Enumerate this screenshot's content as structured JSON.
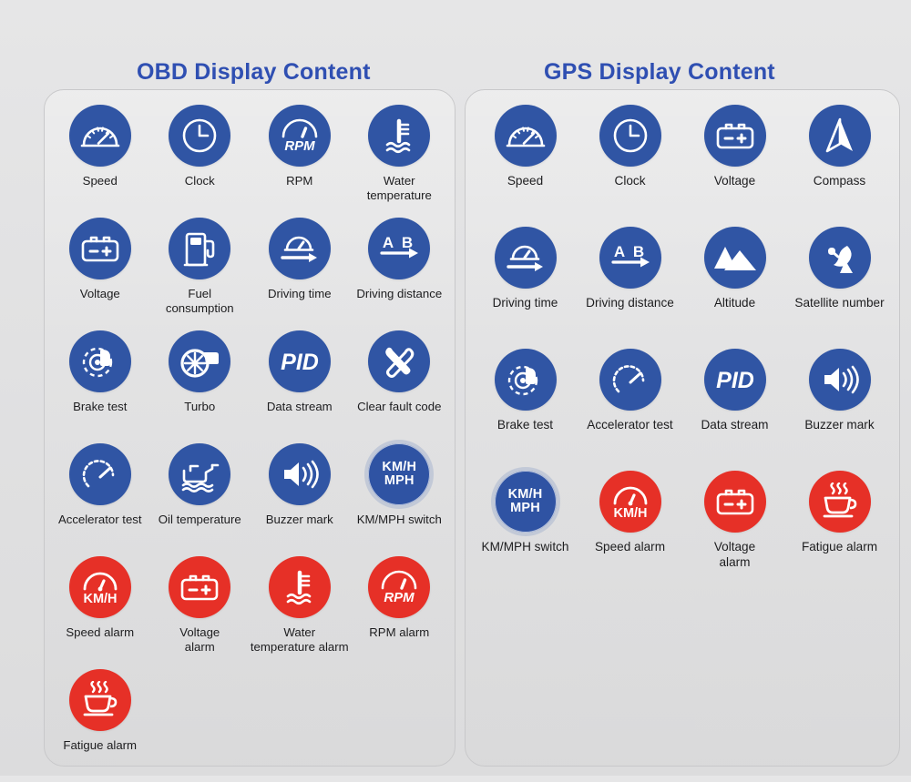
{
  "theme": {
    "background": "#e3e3e4",
    "panel_border": "#c8c8ca",
    "title_color": "#2f4fb2",
    "badge_blue": "#3055a4",
    "badge_red": "#e63027",
    "caption_color": "#1d1d1f"
  },
  "panels": [
    {
      "id": "obd",
      "title": "OBD Display Content",
      "items": [
        {
          "label": "Speed",
          "icon": "speedometer-icon",
          "color": "blue"
        },
        {
          "label": "Clock",
          "icon": "clock-icon",
          "color": "blue"
        },
        {
          "label": "RPM",
          "icon": "rpm-gauge-icon",
          "color": "blue"
        },
        {
          "label": "Water\ntemperature",
          "icon": "water-temperature-icon",
          "color": "blue"
        },
        {
          "label": "Voltage",
          "icon": "battery-icon",
          "color": "blue"
        },
        {
          "label": "Fuel\nconsumption",
          "icon": "fuel-pump-icon",
          "color": "blue"
        },
        {
          "label": "Driving time",
          "icon": "driving-time-icon",
          "color": "blue"
        },
        {
          "label": "Driving distance",
          "icon": "driving-distance-icon",
          "color": "blue"
        },
        {
          "label": "Brake test",
          "icon": "brake-disc-icon",
          "color": "blue"
        },
        {
          "label": "Turbo",
          "icon": "turbo-icon",
          "color": "blue"
        },
        {
          "label": "Data stream",
          "icon": "pid-icon",
          "color": "blue"
        },
        {
          "label": "Clear fault code",
          "icon": "wrench-spanner-icon",
          "color": "blue"
        },
        {
          "label": "Accelerator test",
          "icon": "accelerator-gauge-icon",
          "color": "blue"
        },
        {
          "label": "Oil temperature",
          "icon": "oil-can-icon",
          "color": "blue"
        },
        {
          "label": "Buzzer mark",
          "icon": "speaker-icon",
          "color": "blue"
        },
        {
          "label": "KM/MPH switch",
          "icon": "km-mph-switch-icon",
          "color": "blue-ring",
          "glyph": "KM/H\nMPH"
        },
        {
          "label": "Speed alarm",
          "icon": "speed-alarm-icon",
          "color": "red",
          "glyph": "KM/H"
        },
        {
          "label": "Voltage\nalarm",
          "icon": "battery-icon",
          "color": "red"
        },
        {
          "label": "Water\ntemperature alarm",
          "icon": "water-temperature-icon",
          "color": "red"
        },
        {
          "label": "RPM alarm",
          "icon": "rpm-gauge-icon",
          "color": "red"
        },
        {
          "label": "Fatigue alarm",
          "icon": "coffee-cup-icon",
          "color": "red"
        }
      ]
    },
    {
      "id": "gps",
      "title": "GPS Display Content",
      "items": [
        {
          "label": "Speed",
          "icon": "speedometer-icon",
          "color": "blue"
        },
        {
          "label": "Clock",
          "icon": "clock-icon",
          "color": "blue"
        },
        {
          "label": "Voltage",
          "icon": "battery-icon",
          "color": "blue"
        },
        {
          "label": "Compass",
          "icon": "compass-arrow-icon",
          "color": "blue"
        },
        {
          "label": "Driving time",
          "icon": "driving-time-icon",
          "color": "blue"
        },
        {
          "label": "Driving distance",
          "icon": "driving-distance-icon",
          "color": "blue"
        },
        {
          "label": "Altitude",
          "icon": "mountain-icon",
          "color": "blue"
        },
        {
          "label": "Satellite number",
          "icon": "satellite-dish-icon",
          "color": "blue"
        },
        {
          "label": "Brake test",
          "icon": "brake-disc-icon",
          "color": "blue"
        },
        {
          "label": "Accelerator test",
          "icon": "accelerator-gauge-icon",
          "color": "blue"
        },
        {
          "label": "Data stream",
          "icon": "pid-icon",
          "color": "blue"
        },
        {
          "label": "Buzzer mark",
          "icon": "speaker-icon",
          "color": "blue"
        },
        {
          "label": "KM/MPH switch",
          "icon": "km-mph-switch-icon",
          "color": "blue-ring",
          "glyph": "KM/H\nMPH"
        },
        {
          "label": "Speed alarm",
          "icon": "speed-alarm-icon",
          "color": "red",
          "glyph": "KM/H"
        },
        {
          "label": "Voltage\nalarm",
          "icon": "battery-icon",
          "color": "red"
        },
        {
          "label": "Fatigue alarm",
          "icon": "coffee-cup-icon",
          "color": "red"
        }
      ]
    }
  ]
}
